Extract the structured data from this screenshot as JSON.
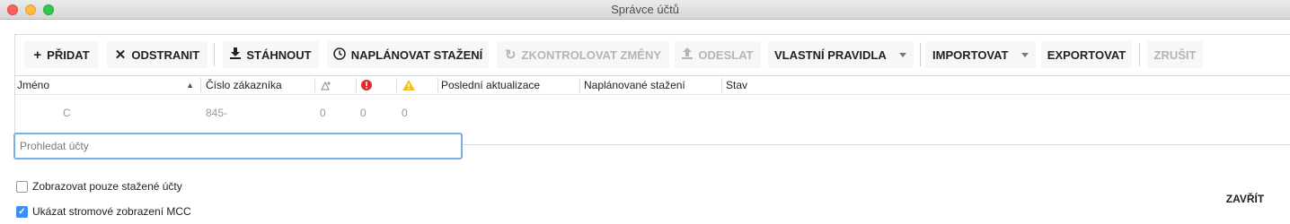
{
  "window": {
    "title": "Správce účtů"
  },
  "toolbar": {
    "add": "PŘIDAT",
    "remove": "ODSTRANIT",
    "download": "STÁHNOUT",
    "schedule": "NAPLÁNOVAT STAŽENÍ",
    "check_changes": "ZKONTROLOVAT ZMĚNY",
    "send": "ODESLAT",
    "custom_rules": "VLASTNÍ PRAVIDLA",
    "import": "IMPORTOVAT",
    "export": "EXPORTOVAT",
    "cancel": "ZRUŠIT"
  },
  "icons": {
    "add": "plus-icon",
    "remove": "x-icon",
    "download": "download-icon",
    "schedule": "clock-icon",
    "check_changes": "refresh-icon",
    "send": "upload-icon",
    "sort": "sort-ascending-icon",
    "changes": "triangle-plus-icon",
    "errors": "error-icon",
    "warnings": "warning-icon"
  },
  "colors": {
    "error": "#e3282e",
    "warning": "#f2c219",
    "focus": "#7aaee8",
    "checkbox": "#3a8ff6"
  },
  "table": {
    "columns": {
      "name": "Jméno",
      "customer_number": "Číslo zákazníka",
      "last_update": "Poslední aktualizace",
      "scheduled_download": "Naplánované stažení",
      "status": "Stav"
    },
    "rows": [
      {
        "name": "C",
        "customer_number": "845-",
        "changes": "0",
        "errors": "0",
        "warnings": "0",
        "last_update": "",
        "scheduled_download": "",
        "status": ""
      }
    ]
  },
  "search": {
    "placeholder": "Prohledat účty",
    "value": ""
  },
  "options": {
    "show_downloaded_only": {
      "label": "Zobrazovat pouze stažené účty",
      "checked": false
    },
    "show_mcc_tree": {
      "label": "Ukázat stromové zobrazení MCC",
      "checked": true
    }
  },
  "footer": {
    "close": "ZAVŘÍT"
  }
}
